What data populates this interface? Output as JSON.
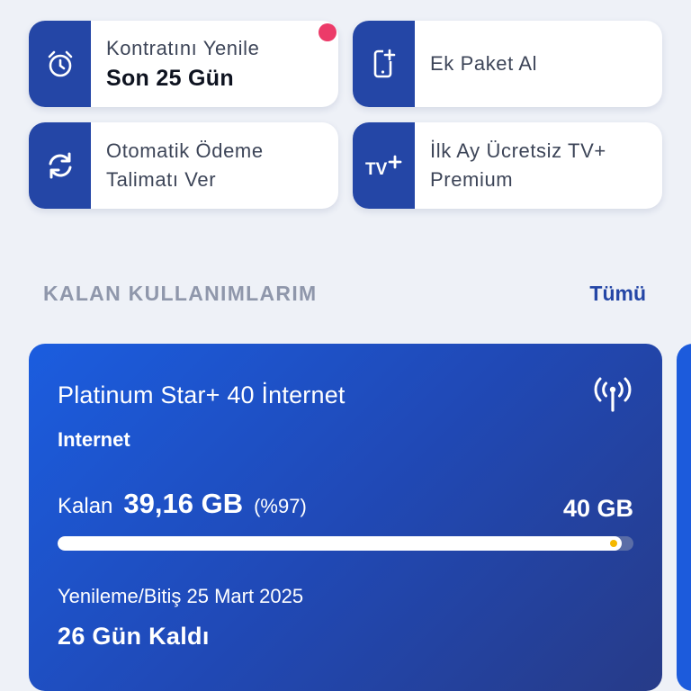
{
  "quick_actions": [
    {
      "icon": "alarm-clock-icon",
      "line1": "Kontratını Yenile",
      "line2": "Son 25 Gün",
      "has_notification": true
    },
    {
      "icon": "phone-add-icon",
      "line1": "Ek Paket Al"
    },
    {
      "icon": "refresh-icon",
      "line1": "Otomatik Ödeme",
      "line2": "Talimatı Ver"
    },
    {
      "icon": "tv-plus-icon",
      "line1": "İlk Ay Ücretsiz TV+",
      "line2": "Premium"
    }
  ],
  "usage_section": {
    "title": "KALAN KULLANIMLARIM",
    "see_all": "Tümü"
  },
  "usage_card": {
    "package_name": "Platinum Star+ 40 İnternet",
    "type": "Internet",
    "icon": "signal-tower-icon",
    "remaining_label": "Kalan",
    "remaining_value": "39,16 GB",
    "remaining_percent": "(%97)",
    "total": "40 GB",
    "progress_fraction": 0.979,
    "renewal": "Yenileme/Bitiş 25 Mart 2025",
    "days_left": "26 Gün Kaldı"
  },
  "colors": {
    "accent": "#2446a6",
    "notification": "#ec3b69",
    "card_gradient_start": "#1b5ddf",
    "card_gradient_end": "#273b88",
    "progress_marker": "#f5b800"
  }
}
